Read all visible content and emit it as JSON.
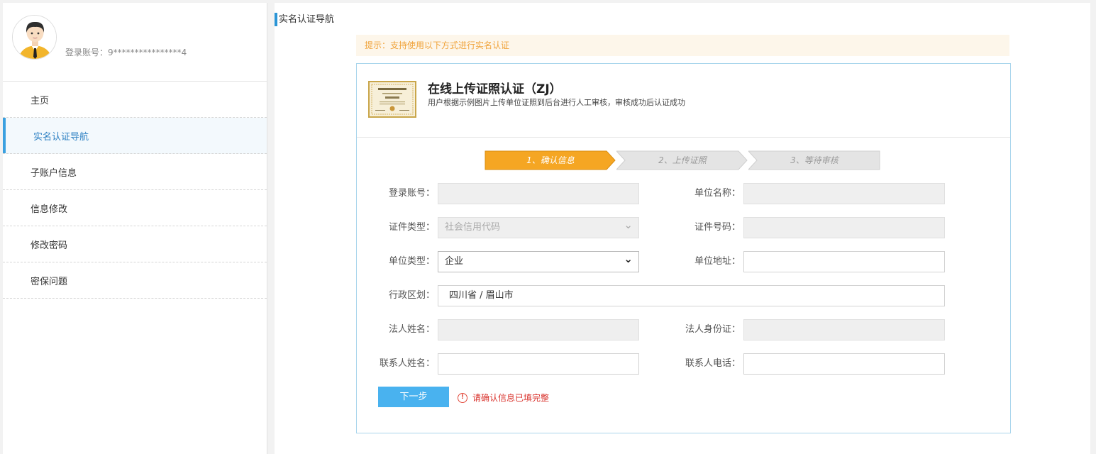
{
  "profile": {
    "account_label": "登录账号：9****************4"
  },
  "nav": {
    "items": [
      {
        "label": "主页"
      },
      {
        "label": "实名认证导航"
      },
      {
        "label": "子账户信息"
      },
      {
        "label": "信息修改"
      },
      {
        "label": "修改密码"
      },
      {
        "label": "密保问题"
      }
    ],
    "active_index": 1
  },
  "page": {
    "title": "实名认证导航",
    "tip": "提示：支持使用以下方式进行实名认证"
  },
  "card": {
    "title": "在线上传证照认证（ZJ）",
    "subtitle": "用户根据示例图片上传单位证照到后台进行人工审核，审核成功后认证成功"
  },
  "steps": [
    {
      "label": "1、确认信息",
      "state": "active"
    },
    {
      "label": "2、上传证照",
      "state": "inactive"
    },
    {
      "label": "3、等待审核",
      "state": "inactive"
    }
  ],
  "form": {
    "login_account": {
      "label": "登录账号：",
      "value": ""
    },
    "unit_name": {
      "label": "单位名称：",
      "value": ""
    },
    "cert_type": {
      "label": "证件类型：",
      "value": "社会信用代码"
    },
    "cert_number": {
      "label": "证件号码：",
      "value": ""
    },
    "unit_type": {
      "label": "单位类型：",
      "value": "企业"
    },
    "unit_address": {
      "label": "单位地址：",
      "value": ""
    },
    "region": {
      "label": "行政区划：",
      "value": "四川省 / 眉山市"
    },
    "legal_name": {
      "label": "法人姓名：",
      "value": ""
    },
    "legal_id": {
      "label": "法人身份证：",
      "value": ""
    },
    "contact_name": {
      "label": "联系人姓名：",
      "value": ""
    },
    "contact_phone": {
      "label": "联系人电话：",
      "value": ""
    }
  },
  "actions": {
    "next_label": "下一步",
    "warning": "请确认信息已填完整"
  },
  "colors": {
    "accent": "#2b95d6",
    "step_active": "#f5a623",
    "button": "#49b2ef",
    "warning": "#d9312b"
  }
}
